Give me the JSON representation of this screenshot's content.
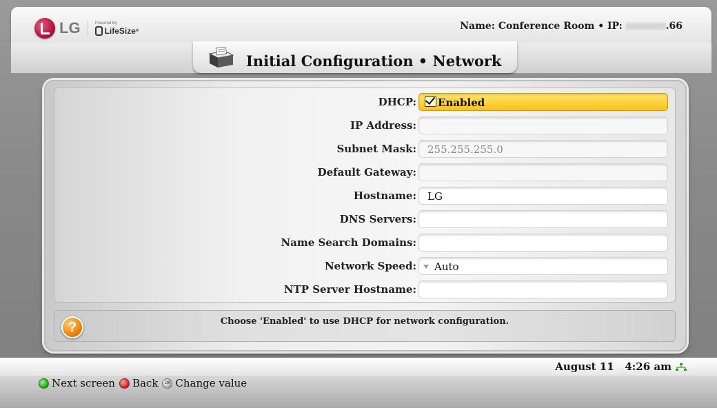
{
  "header": {
    "brand": "LG",
    "powered_by": "Powered By",
    "product": "LifeSize",
    "product_mark": "®",
    "connection_prefix": "Name: Conference Room • IP:",
    "ip_suffix": ".66"
  },
  "page": {
    "title": "Initial Configuration • Network"
  },
  "form": {
    "dhcp": {
      "label": "DHCP:",
      "value": "Enabled",
      "checked": true
    },
    "ip_address": {
      "label": "IP Address:",
      "value": ""
    },
    "subnet_mask": {
      "label": "Subnet Mask:",
      "value": "255.255.255.0"
    },
    "default_gateway": {
      "label": "Default Gateway:",
      "value": ""
    },
    "hostname": {
      "label": "Hostname:",
      "value": "LG"
    },
    "dns_servers": {
      "label": "DNS Servers:",
      "value": ""
    },
    "name_search_domains": {
      "label": "Name Search Domains:",
      "value": ""
    },
    "network_speed": {
      "label": "Network Speed:",
      "value": "Auto"
    },
    "ntp_server_hostname": {
      "label": "NTP Server Hostname:",
      "value": ""
    }
  },
  "help": {
    "text": "Choose 'Enabled' to use DHCP for network configuration."
  },
  "status": {
    "date": "August 11",
    "time": "4:26 am"
  },
  "hints": {
    "next": "Next screen",
    "back": "Back",
    "change": "Change value",
    "ok_key": "OK"
  },
  "colors": {
    "selected_field": "#f9c21a",
    "brand_red": "#b4123f",
    "help_orange": "#f08a10"
  }
}
